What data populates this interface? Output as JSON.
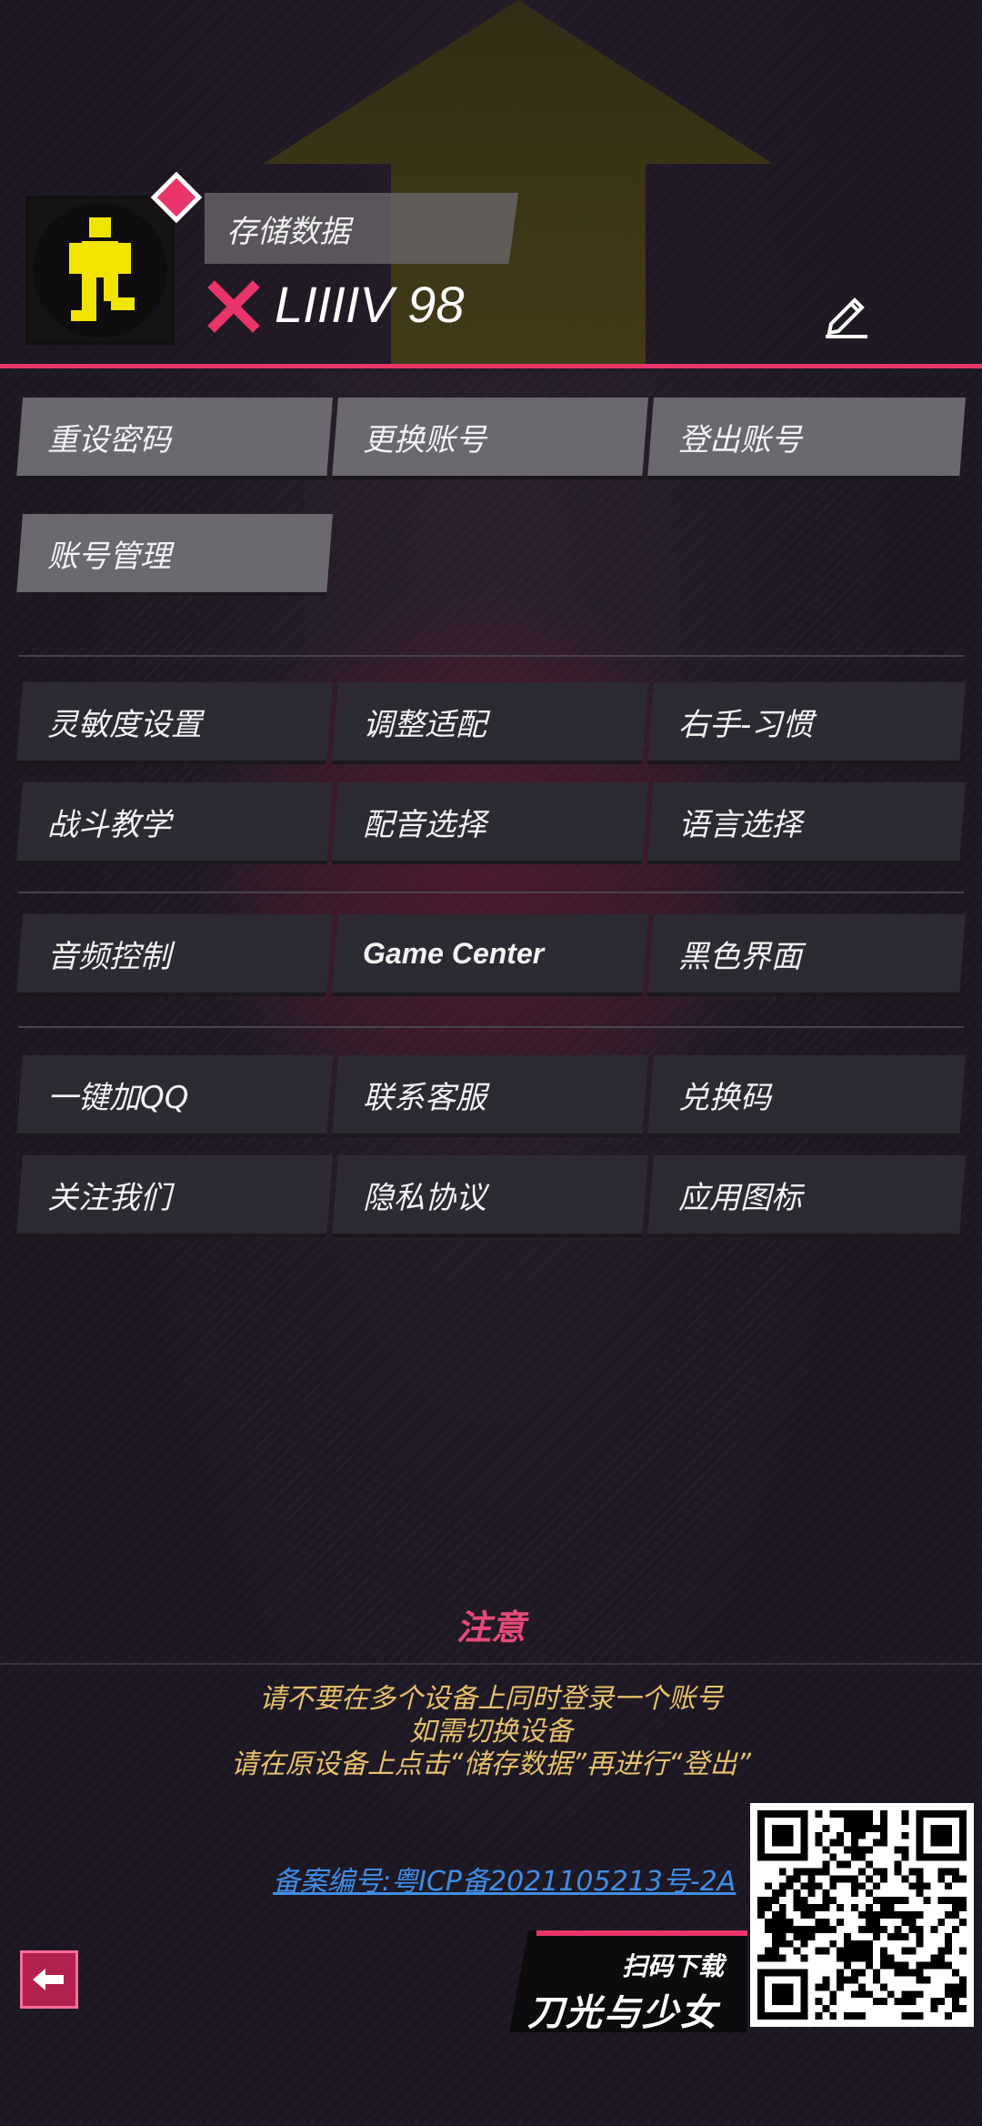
{
  "profile": {
    "save_data_label": "存储数据",
    "player_name": "LIIIIV 98"
  },
  "account_buttons": [
    {
      "label": "重设密码"
    },
    {
      "label": "更换账号"
    },
    {
      "label": "登出账号"
    },
    {
      "label": "账号管理"
    }
  ],
  "settings_buttons": [
    {
      "label": "灵敏度设置"
    },
    {
      "label": "调整适配"
    },
    {
      "label": "右手-习惯"
    },
    {
      "label": "战斗教学"
    },
    {
      "label": "配音选择"
    },
    {
      "label": "语言选择"
    }
  ],
  "misc_buttons": [
    {
      "label": "音频控制"
    },
    {
      "label": "Game Center"
    },
    {
      "label": "黑色界面"
    }
  ],
  "social_buttons": [
    {
      "label": "一键加QQ"
    },
    {
      "label": "联系客服"
    },
    {
      "label": "兑换码"
    },
    {
      "label": "关注我们"
    },
    {
      "label": "隐私协议"
    },
    {
      "label": "应用图标"
    }
  ],
  "notice": {
    "title": "注意",
    "lines": [
      "请不要在多个设备上同时登录一个账号",
      "如需切换设备",
      "请在原设备上点击“储存数据”再进行“登出”"
    ]
  },
  "icp": "备案编号:粤ICP备2021105213号-2A",
  "download": {
    "small": "扫码下载",
    "logo": "刀光与少女"
  },
  "colors": {
    "accent": "#e8356a",
    "notice_text": "#e6c06b",
    "link": "#3f8ee8"
  }
}
